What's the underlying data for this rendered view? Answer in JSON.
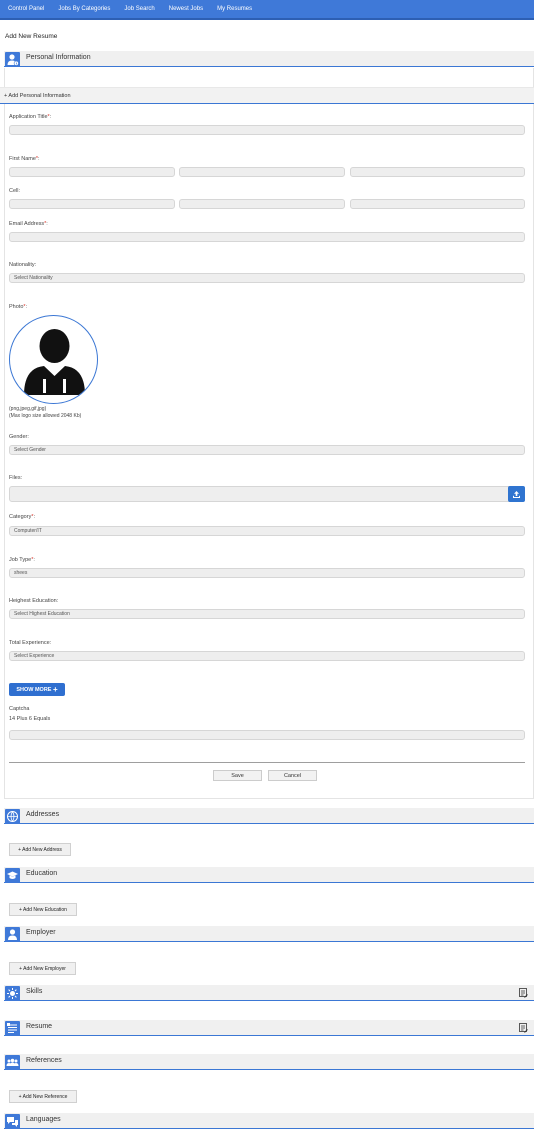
{
  "nav": {
    "items": [
      "Control Panel",
      "Jobs By Categories",
      "Job Search",
      "Newest Jobs",
      "My Resumes"
    ]
  },
  "page_title": "Add New Resume",
  "sections": {
    "personal": "Personal Information",
    "addresses": "Addresses",
    "education": "Education",
    "employer": "Employer",
    "skills": "Skills",
    "resume": "Resume",
    "references": "References",
    "languages": "Languages"
  },
  "personal_sub": "+ Add Personal Information",
  "fields": {
    "application_title": "Application Title",
    "first_name": "First Name",
    "cell": "Cell:",
    "email": "Email Address",
    "nationality": "Nationality:",
    "nationality_value": "Select Nationality",
    "photo": "Photo",
    "photo_note_1": "(png,jpeg,gif,jpg)",
    "photo_note_2": "(Max logo size allowed 2048 Kb)",
    "gender": "Gender:",
    "gender_value": "Select Gender",
    "files": "Files:",
    "category": "Category",
    "category_value": "Computer/IT",
    "job_type": "Job Type",
    "job_type_value": "shees",
    "education": "Heighest Education:",
    "education_value": "Select Highest Education",
    "experience": "Total Experience:",
    "experience_value": "Select Experience",
    "captcha": "Captcha",
    "captcha_question": "14 Plus 6 Equals"
  },
  "required_mark": "*",
  "required_suffix": ":",
  "show_more": "SHOW MORE",
  "show_more_plus": "+",
  "buttons": {
    "save": "Save",
    "cancel": "Cancel",
    "add_address": "+ Add New Address",
    "add_education": "+ Add New Education",
    "add_employer": "+ Add New Employer",
    "add_reference": "+ Add New Reference"
  },
  "colors": {
    "accent": "#3f79d8",
    "required": "#d93025"
  }
}
